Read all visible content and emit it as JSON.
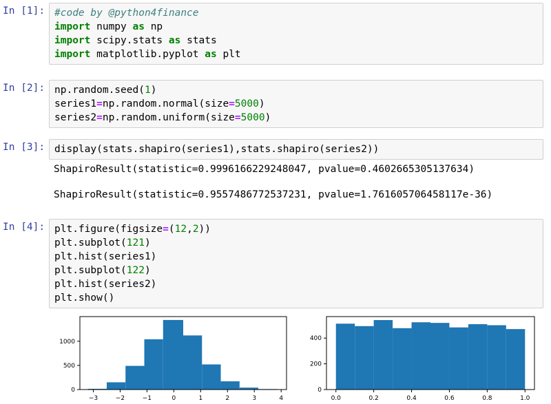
{
  "cells": [
    {
      "prompt": "In [1]:",
      "lines": [
        [
          {
            "t": "#code by @python4finance",
            "c": "cm"
          }
        ],
        [
          {
            "t": "import",
            "c": "kw"
          },
          {
            "t": " numpy ",
            "c": ""
          },
          {
            "t": "as",
            "c": "kw"
          },
          {
            "t": " np",
            "c": ""
          }
        ],
        [
          {
            "t": "import",
            "c": "kw"
          },
          {
            "t": " scipy.stats ",
            "c": ""
          },
          {
            "t": "as",
            "c": "kw"
          },
          {
            "t": " stats",
            "c": ""
          }
        ],
        [
          {
            "t": "import",
            "c": "kw"
          },
          {
            "t": " matplotlib.pyplot ",
            "c": ""
          },
          {
            "t": "as",
            "c": "kw"
          },
          {
            "t": " plt",
            "c": ""
          }
        ]
      ]
    },
    {
      "prompt": "In [2]:",
      "lines": [
        [
          {
            "t": "np.random.seed(",
            "c": ""
          },
          {
            "t": "1",
            "c": "num"
          },
          {
            "t": ")",
            "c": ""
          }
        ],
        [
          {
            "t": "series1",
            "c": ""
          },
          {
            "t": "=",
            "c": "op"
          },
          {
            "t": "np.random.normal(size",
            "c": ""
          },
          {
            "t": "=",
            "c": "op"
          },
          {
            "t": "5000",
            "c": "num"
          },
          {
            "t": ")",
            "c": ""
          }
        ],
        [
          {
            "t": "series2",
            "c": ""
          },
          {
            "t": "=",
            "c": "op"
          },
          {
            "t": "np.random.uniform(size",
            "c": ""
          },
          {
            "t": "=",
            "c": "op"
          },
          {
            "t": "5000",
            "c": "num"
          },
          {
            "t": ")",
            "c": ""
          }
        ]
      ]
    },
    {
      "prompt": "In [3]:",
      "lines": [
        [
          {
            "t": "display(stats.shapiro(series1),stats.shapiro(series2))",
            "c": ""
          }
        ]
      ],
      "outputs": [
        "ShapiroResult(statistic=0.9996166229248047, pvalue=0.4602665305137634)",
        "ShapiroResult(statistic=0.9557486772537231, pvalue=1.761605706458117e-36)"
      ]
    },
    {
      "prompt": "In [4]:",
      "lines": [
        [
          {
            "t": "plt.figure(figsize",
            "c": ""
          },
          {
            "t": "=",
            "c": "op"
          },
          {
            "t": "(",
            "c": ""
          },
          {
            "t": "12",
            "c": "num"
          },
          {
            "t": ",",
            "c": ""
          },
          {
            "t": "2",
            "c": "num"
          },
          {
            "t": "))",
            "c": ""
          }
        ],
        [
          {
            "t": "plt.subplot(",
            "c": ""
          },
          {
            "t": "121",
            "c": "num"
          },
          {
            "t": ")",
            "c": ""
          }
        ],
        [
          {
            "t": "plt.hist(series1)",
            "c": ""
          }
        ],
        [
          {
            "t": "plt.subplot(",
            "c": ""
          },
          {
            "t": "122",
            "c": "num"
          },
          {
            "t": ")",
            "c": ""
          }
        ],
        [
          {
            "t": "plt.hist(series2)",
            "c": ""
          }
        ],
        [
          {
            "t": "plt.show()",
            "c": ""
          }
        ]
      ]
    }
  ],
  "colors": {
    "prompt": "#303f9f",
    "bar": "#1f77b4",
    "keyword": "#008000",
    "comment": "#408080",
    "operator": "#aa22ff"
  },
  "chart_data": [
    {
      "type": "bar",
      "bin_edges": [
        -3.2,
        -2.5,
        -1.8,
        -1.1,
        -0.4,
        0.35,
        1.05,
        1.75,
        2.45,
        3.15,
        3.85
      ],
      "values": [
        15,
        150,
        490,
        1040,
        1440,
        1120,
        520,
        170,
        40,
        10
      ],
      "xlim": [
        -3.5,
        4.2
      ],
      "ylim": [
        0,
        1510
      ],
      "xticks": [
        -3,
        -2,
        -1,
        0,
        1,
        2,
        3,
        4
      ],
      "xtick_labels": [
        "−3",
        "−2",
        "−1",
        "0",
        "1",
        "2",
        "3",
        "4"
      ],
      "yticks": [
        0,
        500,
        1000
      ],
      "ytick_labels": [
        "0",
        "500",
        "1000"
      ],
      "title": "",
      "xlabel": "",
      "ylabel": "",
      "grid": false
    },
    {
      "type": "bar",
      "bin_edges": [
        0.0,
        0.1,
        0.2,
        0.3,
        0.4,
        0.5,
        0.6,
        0.7,
        0.8,
        0.9,
        1.0
      ],
      "values": [
        512,
        493,
        540,
        477,
        523,
        518,
        483,
        508,
        500,
        470
      ],
      "xlim": [
        -0.05,
        1.05
      ],
      "ylim": [
        0,
        567
      ],
      "xticks": [
        0.0,
        0.2,
        0.4,
        0.6,
        0.8,
        1.0
      ],
      "xtick_labels": [
        "0.0",
        "0.2",
        "0.4",
        "0.6",
        "0.8",
        "1.0"
      ],
      "yticks": [
        0,
        200,
        400
      ],
      "ytick_labels": [
        "0",
        "200",
        "400"
      ],
      "title": "",
      "xlabel": "",
      "ylabel": "",
      "grid": false
    }
  ]
}
